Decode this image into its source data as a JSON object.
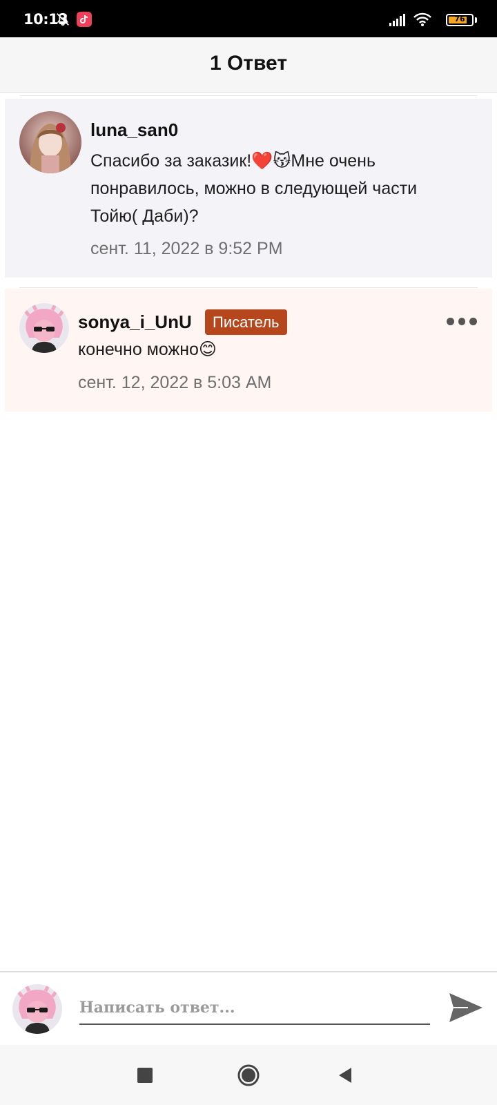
{
  "status_bar": {
    "time": "10:13",
    "battery_level": "76",
    "icons": [
      "bell-off-icon",
      "app-notification-icon",
      "signal-icon",
      "wifi-icon",
      "battery-icon"
    ]
  },
  "header": {
    "title": "1 Ответ"
  },
  "comments": [
    {
      "username": "luna_san0",
      "text": "Спасибо за заказик!❤️😽Мне очень понравилось, можно в следующей части Тойю( Даби)?",
      "timestamp": "сент. 11, 2022 в 9:52 PM"
    },
    {
      "username": "sonya_i_UnU",
      "badge": "Писатель",
      "text": "конечно можно😊",
      "timestamp": "сент. 12, 2022 в 5:03 AM",
      "more_icon": "more-options-icon"
    }
  ],
  "reply": {
    "placeholder": "Написать ответ...",
    "send_icon": "send-icon"
  },
  "colors": {
    "badge": "#b6471d",
    "parent_bg": "#f4f3f7",
    "reply_bg": "#fff6f3"
  },
  "nav_icons": [
    "recents-icon",
    "home-icon",
    "back-icon"
  ]
}
